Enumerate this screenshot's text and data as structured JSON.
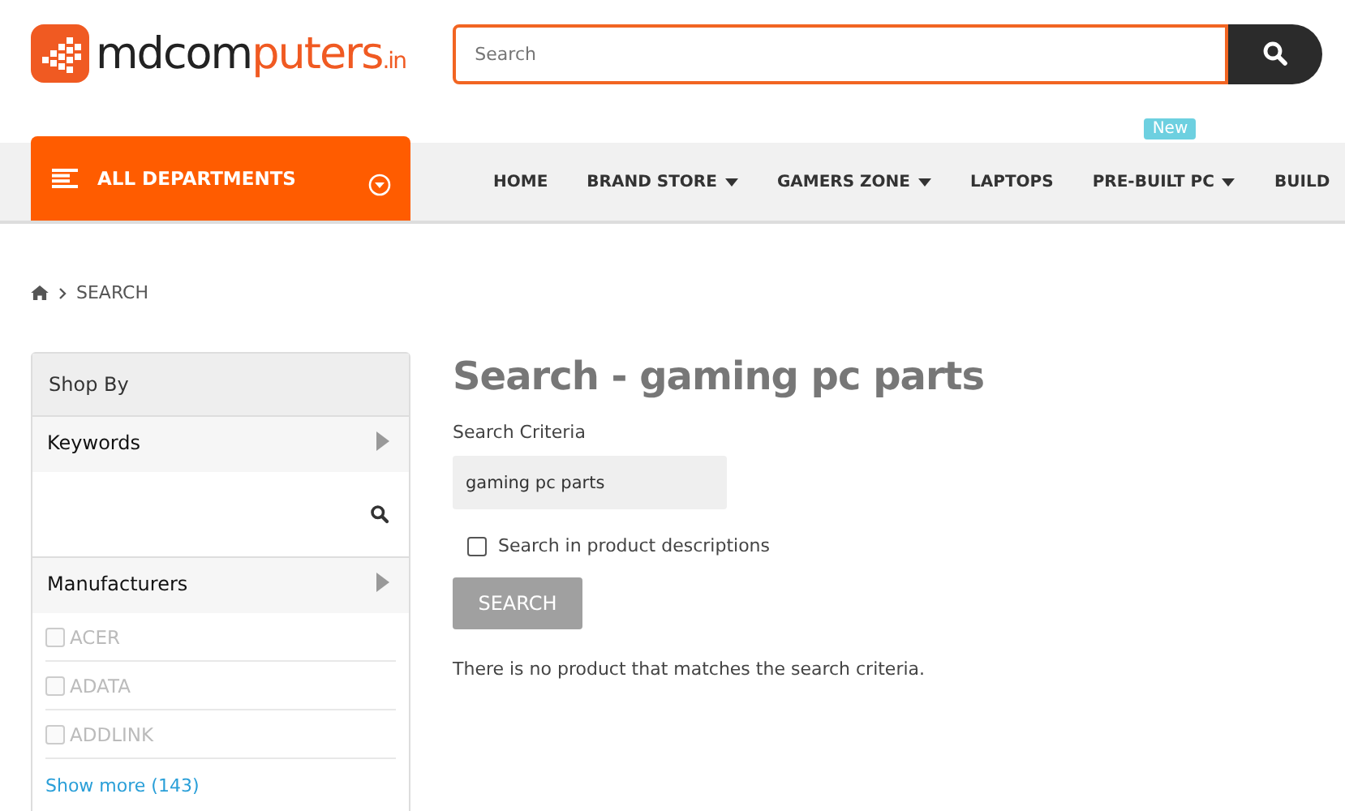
{
  "logo": {
    "dark": "mdcom",
    "accent": "puters",
    "suffix": ".in"
  },
  "search": {
    "placeholder": "Search"
  },
  "departments": {
    "label": "ALL DEPARTMENTS"
  },
  "nav": [
    {
      "label": "HOME",
      "dropdown": false
    },
    {
      "label": "BRAND STORE",
      "dropdown": true
    },
    {
      "label": "GAMERS ZONE",
      "dropdown": true
    },
    {
      "label": "LAPTOPS",
      "dropdown": false
    },
    {
      "label": "PRE-BUILT PC",
      "dropdown": true,
      "badge": "New"
    },
    {
      "label": "BUILD",
      "dropdown": false
    }
  ],
  "breadcrumb": [
    "SEARCH"
  ],
  "sidebar": {
    "title": "Shop By",
    "sections": [
      {
        "kind": "search",
        "title": "Keywords"
      },
      {
        "kind": "checklist",
        "title": "Manufacturers",
        "items": [
          {
            "label": "ACER",
            "checked": false,
            "disabled": true
          },
          {
            "label": "ADATA",
            "checked": false,
            "disabled": true
          },
          {
            "label": "ADDLINK",
            "checked": false,
            "disabled": true
          }
        ],
        "more": "Show more (143)"
      }
    ]
  },
  "main": {
    "heading": "Search - gaming pc parts",
    "criteria_label": "Search Criteria",
    "criteria_value": "gaming pc parts",
    "descriptions": {
      "label": "Search in product descriptions",
      "checked": false
    },
    "button": "SEARCH",
    "message": "There is no product that matches the search criteria."
  }
}
